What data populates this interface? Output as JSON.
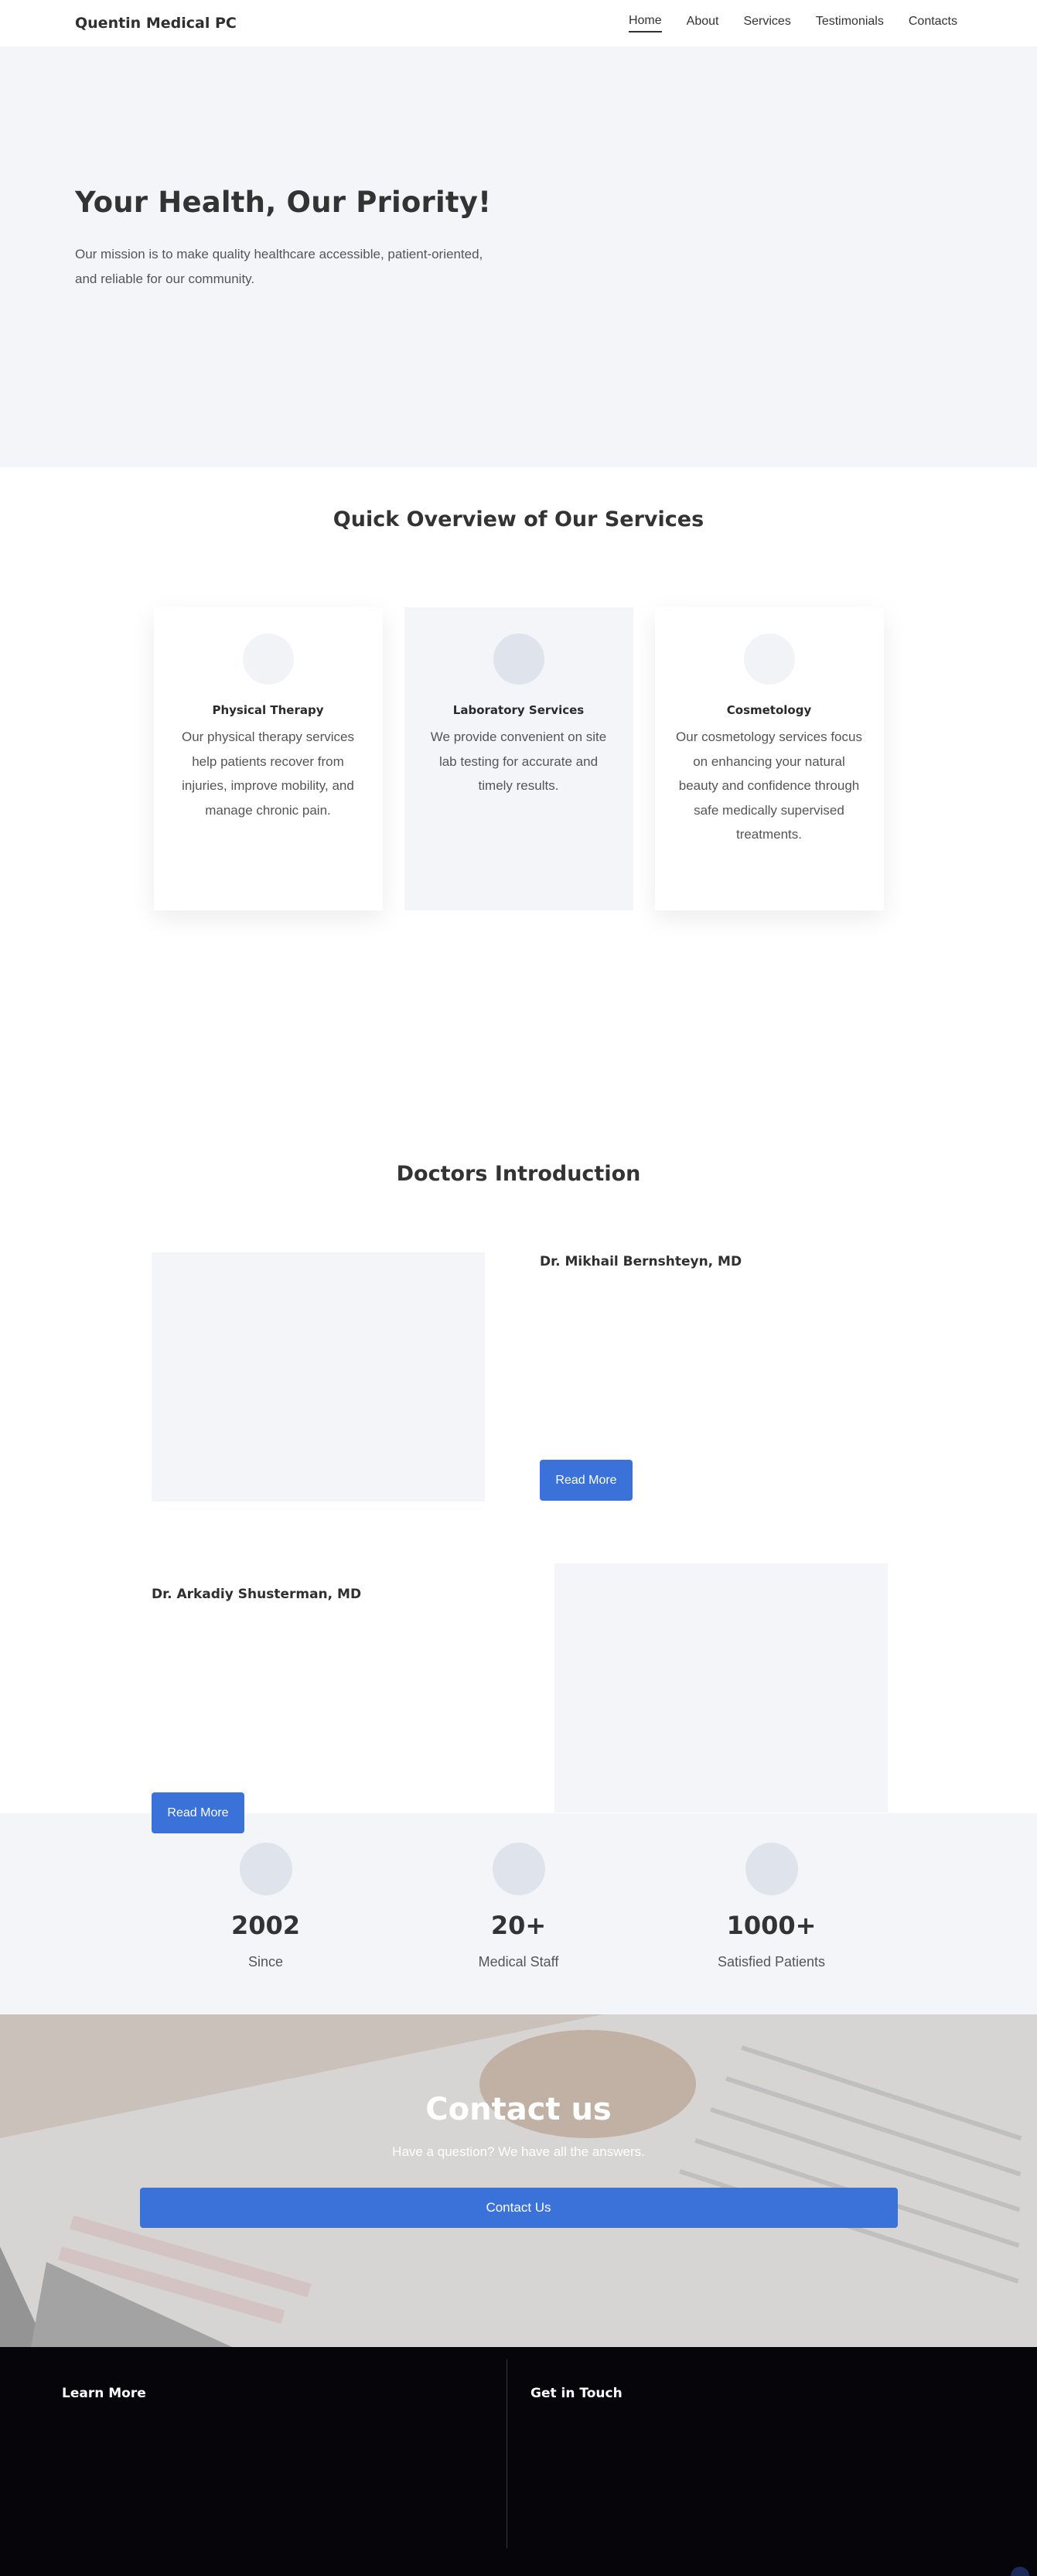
{
  "header": {
    "brand": "Quentin Medical PC",
    "nav": [
      "Home",
      "About",
      "Services",
      "Testimonials",
      "Contacts"
    ],
    "active": "Home"
  },
  "hero": {
    "title": "Your Health, Our Priority!",
    "text": "Our mission is to make quality healthcare accessible, patient-oriented, and reliable for our community."
  },
  "services": {
    "title": "Quick Overview of Our Services",
    "items": [
      {
        "title": "Physical Therapy",
        "text": "Our physical therapy services help patients recover from injuries, improve mobility, and manage chronic pain."
      },
      {
        "title": "Laboratory Services",
        "text": "We provide convenient on site lab testing for accurate and timely results."
      },
      {
        "title": "Cosmetology",
        "text": "Our cosmetology services focus on enhancing your natural beauty and confidence through safe medically supervised treatments."
      }
    ]
  },
  "doctors": {
    "title": "Doctors Introduction",
    "items": [
      {
        "name": "Dr. Mikhail Bernshteyn, MD",
        "button": "Read More"
      },
      {
        "name": "Dr. Arkadiy Shusterman, MD",
        "button": "Read More"
      }
    ]
  },
  "stats": [
    {
      "value": "2002",
      "label": "Since"
    },
    {
      "value": "20+",
      "label": "Medical Staff"
    },
    {
      "value": "1000+",
      "label": "Satisfied Patients"
    }
  ],
  "contact": {
    "title": "Contact us",
    "subtitle": "Have a question? We have all the answers.",
    "button": "Contact Us"
  },
  "footer": {
    "col1": "Learn More",
    "col2": "Get in Touch"
  }
}
